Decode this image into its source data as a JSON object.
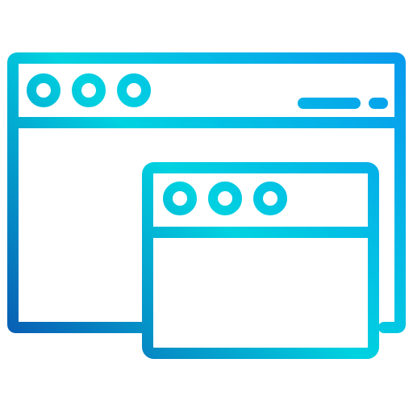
{
  "icon": {
    "name": "browser-windows-icon",
    "style": "outline gradient",
    "gradient_colors": [
      "#0b3fa8",
      "#00d2e0",
      "#0a8ff0"
    ],
    "background_color": "#ffffff",
    "windows": [
      {
        "name": "back-window",
        "header_dots": 3,
        "header_bars": 2
      },
      {
        "name": "front-window",
        "header_dots": 3
      }
    ]
  }
}
